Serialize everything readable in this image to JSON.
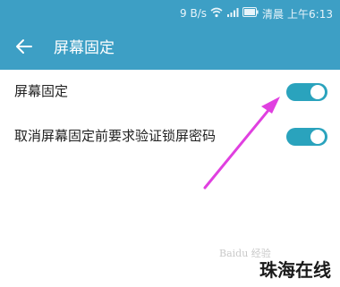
{
  "status_bar": {
    "network_speed": "9 B/s",
    "carrier": "清晨",
    "time": "上午6:13"
  },
  "app_bar": {
    "title": "屏幕固定"
  },
  "settings": [
    {
      "label": "屏幕固定",
      "enabled": true
    },
    {
      "label": "取消屏幕固定前要求验证锁屏密码",
      "enabled": true
    }
  ],
  "overlay": {
    "watermark": "Baidu 经验",
    "brand": "珠海在线"
  },
  "colors": {
    "accent": "#3d9fc5",
    "toggle_on": "#2aa3bd",
    "annotation_arrow": "#e040e0"
  },
  "icons": [
    "wifi-icon",
    "signal-icon",
    "battery-icon",
    "back-arrow-icon"
  ]
}
